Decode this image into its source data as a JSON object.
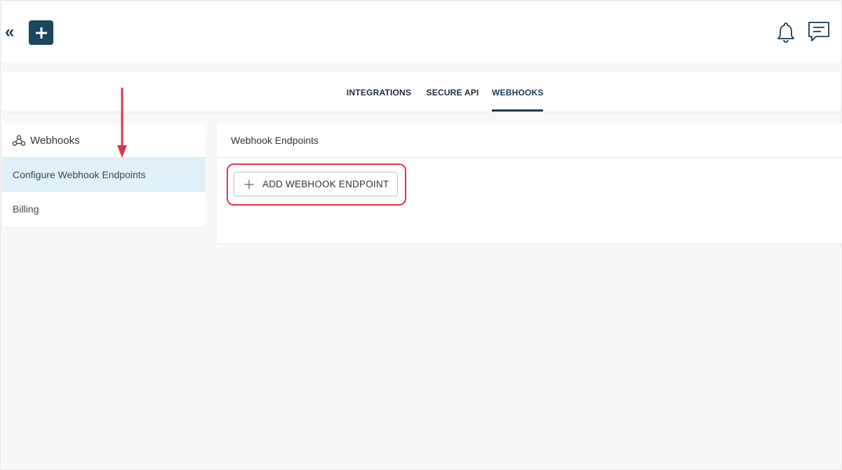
{
  "header": {
    "collapse_label": "«",
    "icons": {
      "add": "plus-icon",
      "notifications": "bell-icon",
      "messages": "chat-icon"
    },
    "brand_color": "#1d4660"
  },
  "tabs": [
    {
      "label": "INTEGRATIONS",
      "active": false
    },
    {
      "label": "SECURE API",
      "active": false
    },
    {
      "label": "WEBHOOKS",
      "active": true
    }
  ],
  "sidebar": {
    "title": "Webhooks",
    "title_icon": "webhook-icon",
    "items": [
      {
        "label": "Configure Webhook Endpoints",
        "selected": true
      },
      {
        "label": "Billing",
        "selected": false
      }
    ],
    "selected_color": "#e0f0f8"
  },
  "main": {
    "title": "Webhook Endpoints",
    "add_button_label": "ADD WEBHOOK ENDPOINT",
    "add_button_icon": "plus-icon"
  },
  "annotation": {
    "color": "#e0344c"
  }
}
